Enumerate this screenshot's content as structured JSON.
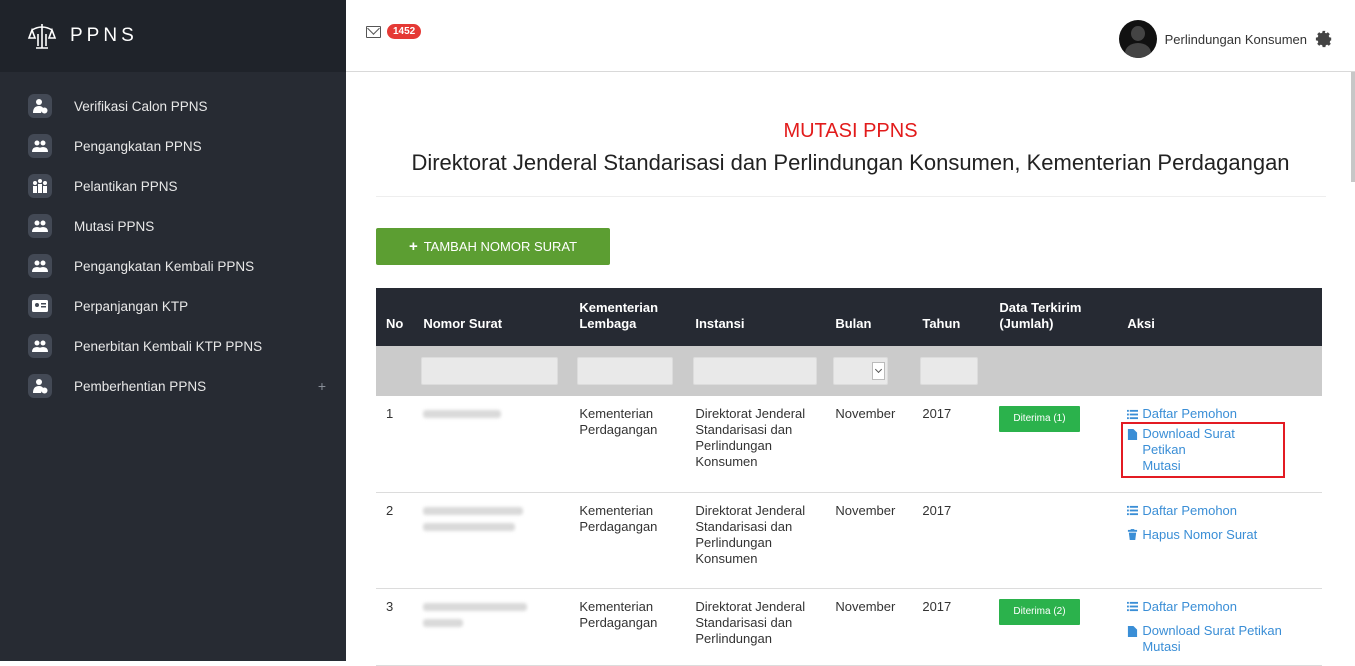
{
  "brand": {
    "name": "PPNS",
    "logo_icon": "scales-logo-icon"
  },
  "sidebar": {
    "items": [
      {
        "label": "Verifikasi Calon PPNS",
        "icon": "user-check-icon"
      },
      {
        "label": "Pengangkatan PPNS",
        "icon": "users-icon"
      },
      {
        "label": "Pelantikan PPNS",
        "icon": "users-group-icon"
      },
      {
        "label": "Mutasi PPNS",
        "icon": "users-icon"
      },
      {
        "label": "Pengangkatan Kembali PPNS",
        "icon": "users-icon"
      },
      {
        "label": "Perpanjangan KTP",
        "icon": "id-card-icon"
      },
      {
        "label": "Penerbitan Kembali KTP PPNS",
        "icon": "users-icon"
      },
      {
        "label": "Pemberhentian PPNS",
        "icon": "user-check-icon",
        "expand": "+"
      }
    ]
  },
  "topbar": {
    "mail_count": "1452",
    "user_name": "Perlindungan Konsumen"
  },
  "main": {
    "title": "MUTASI PPNS",
    "subtitle": "Direktorat Jenderal Standarisasi dan Perlindungan Konsumen, Kementerian Perdagangan",
    "add_button": "TAMBAH NOMOR SURAT"
  },
  "table": {
    "headers": {
      "no": "No",
      "nomor": "Nomor Surat",
      "kementerian_1": "Kementerian",
      "kementerian_2": "Lembaga",
      "instansi": "Instansi",
      "bulan": "Bulan",
      "tahun": "Tahun",
      "data_1": "Data Terkirim",
      "data_2": "(Jumlah)",
      "aksi": "Aksi"
    },
    "rows": [
      {
        "no": "1",
        "kementerian_1": "Kementerian",
        "kementerian_2": "Perdagangan",
        "instansi_1": "Direktorat Jenderal",
        "instansi_2": "Standarisasi dan",
        "instansi_3": "Perlindungan",
        "instansi_4": "Konsumen",
        "bulan": "November",
        "tahun": "2017",
        "status": "Diterima (1)",
        "action_1": "Daftar Pemohon",
        "action_2a": "Download Surat Petikan",
        "action_2b": "Mutasi"
      },
      {
        "no": "2",
        "kementerian_1": "Kementerian",
        "kementerian_2": "Perdagangan",
        "instansi_1": "Direktorat Jenderal",
        "instansi_2": "Standarisasi dan",
        "instansi_3": "Perlindungan",
        "instansi_4": "Konsumen",
        "bulan": "November",
        "tahun": "2017",
        "action_1": "Daftar Pemohon",
        "action_2": "Hapus Nomor Surat"
      },
      {
        "no": "3",
        "kementerian_1": "Kementerian",
        "kementerian_2": "Perdagangan",
        "instansi_1": "Direktorat Jenderal",
        "instansi_2": "Standarisasi dan",
        "instansi_3": "Perlindungan",
        "bulan": "November",
        "tahun": "2017",
        "status": "Diterima (2)",
        "action_1": "Daftar Pemohon",
        "action_2a": "Download Surat Petikan",
        "action_2b": "Mutasi"
      }
    ]
  },
  "colors": {
    "sidebar_bg": "#272b33",
    "accent_green": "#5c9e32",
    "title_red": "#e21b1b",
    "link_blue": "#3a8ed6"
  }
}
